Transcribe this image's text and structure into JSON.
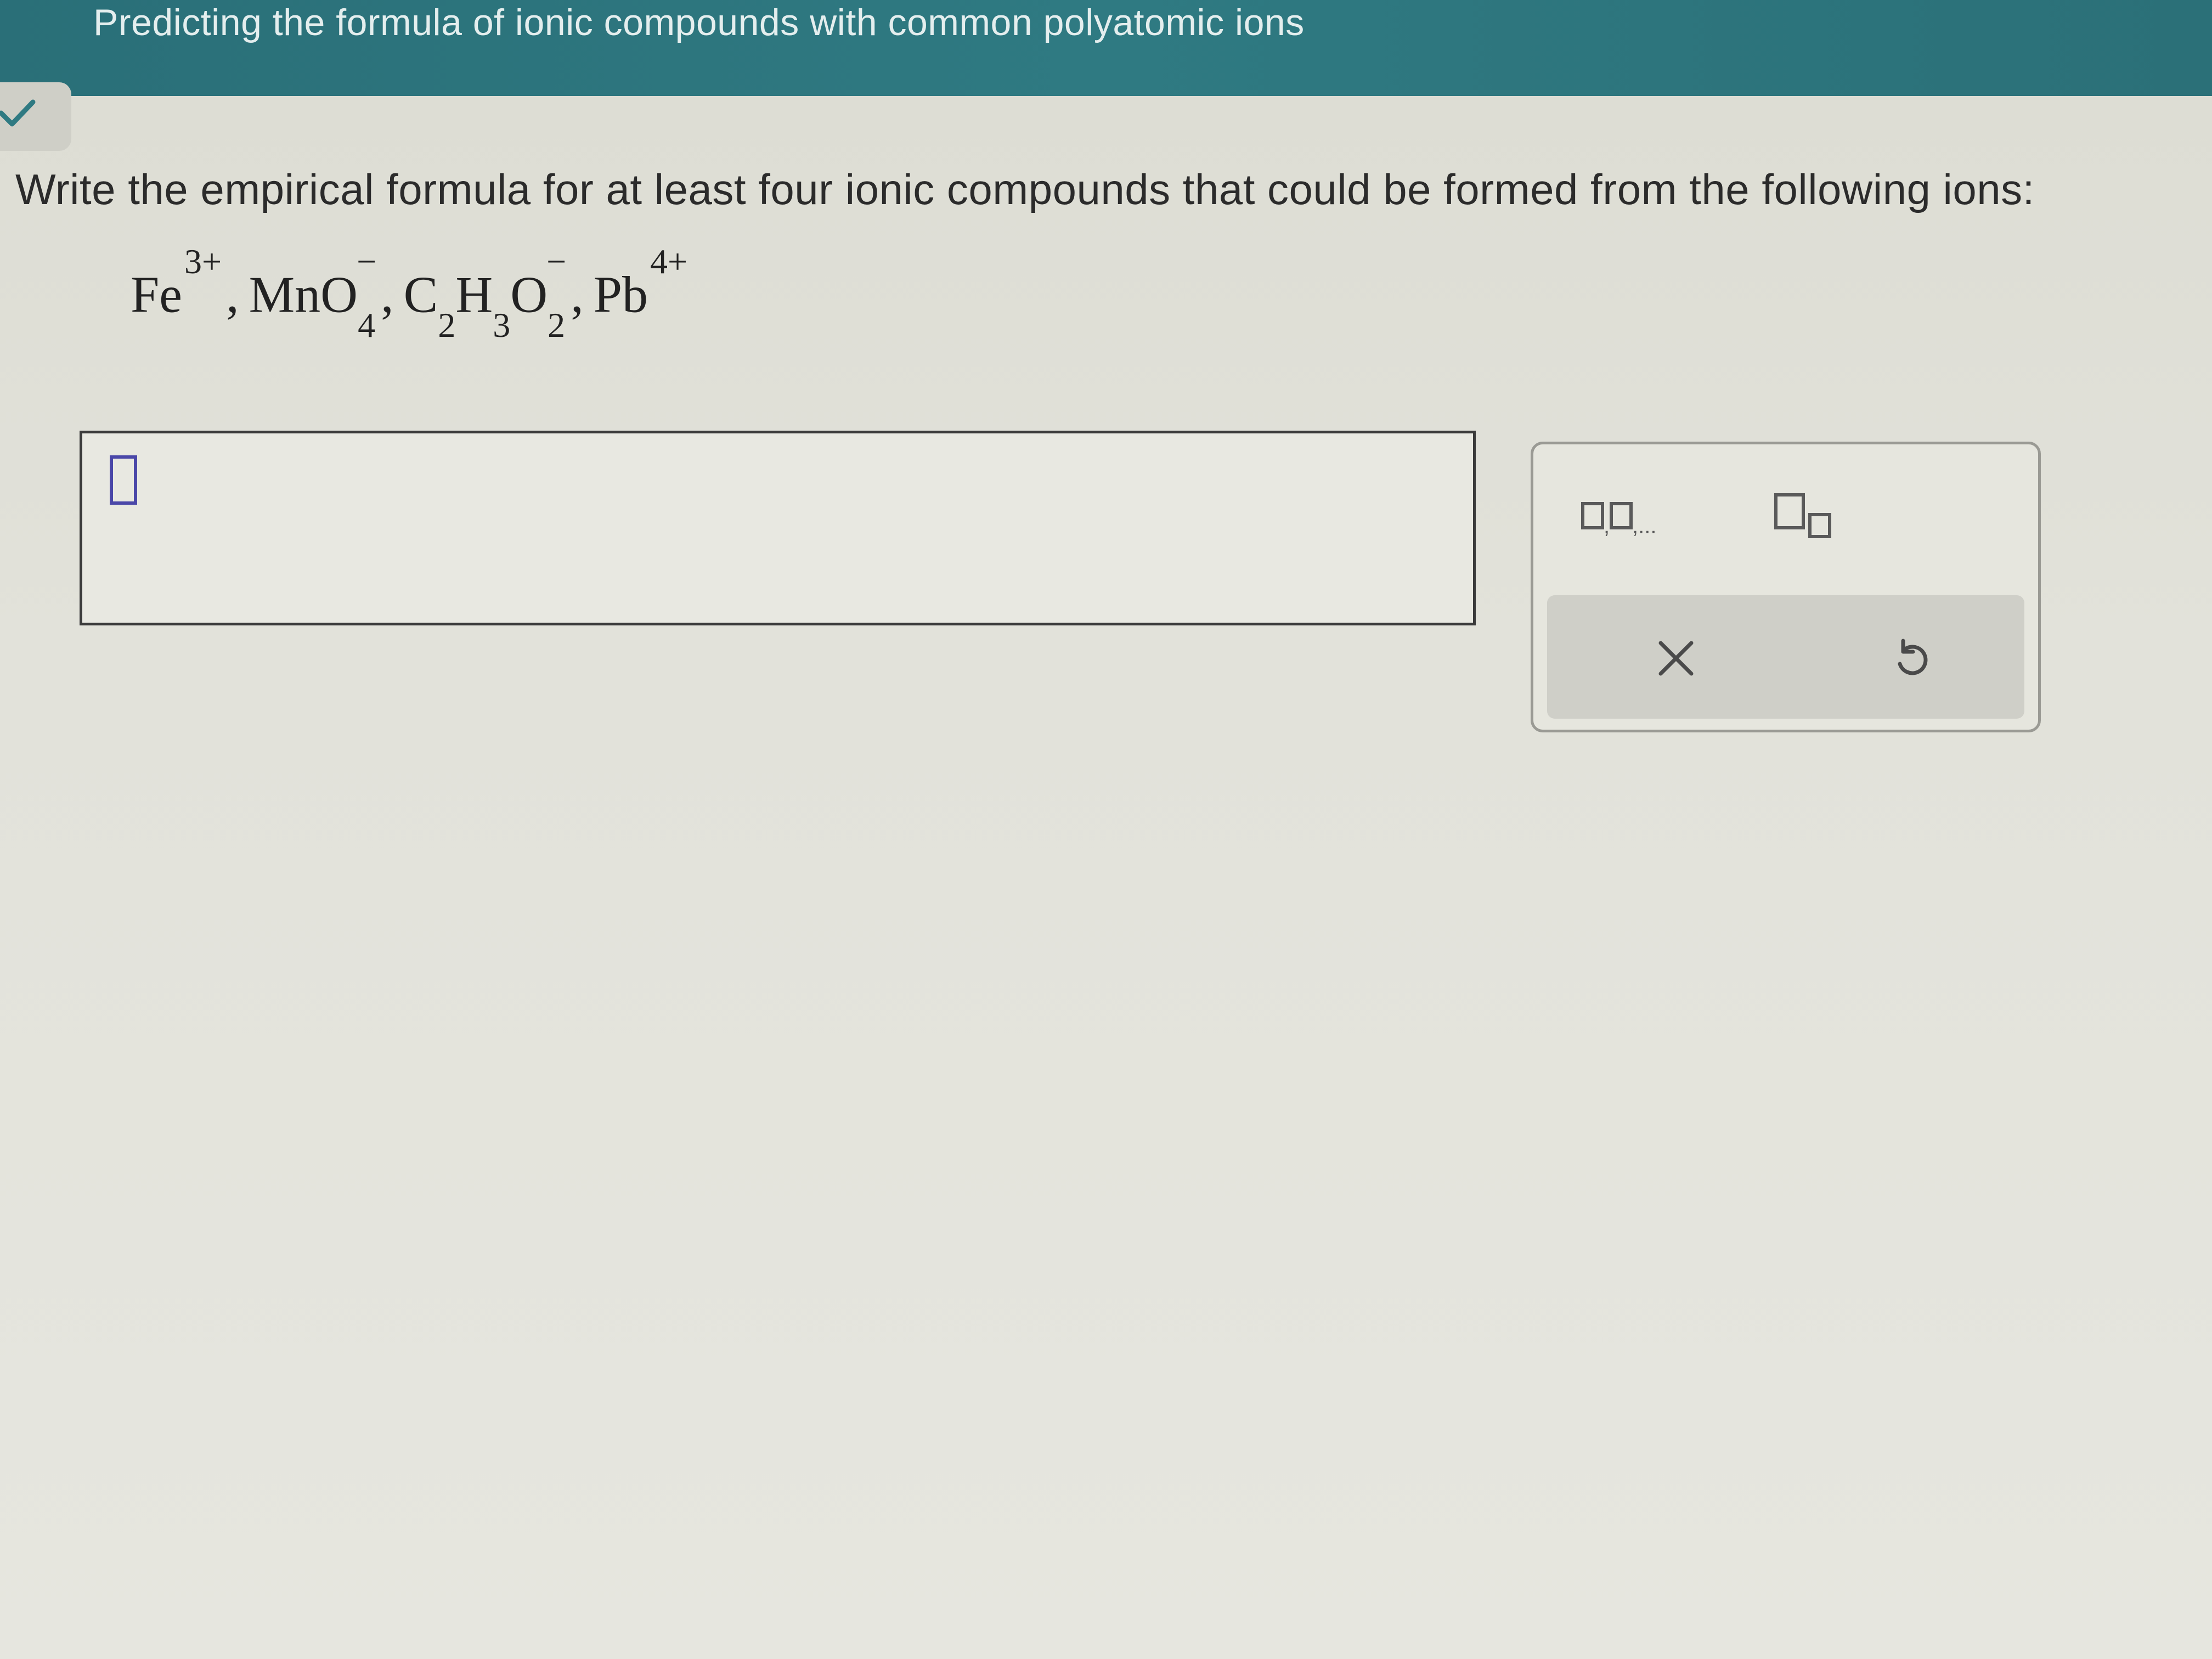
{
  "header": {
    "title": "Predicting the formula of ionic compounds with common polyatomic ions"
  },
  "question": {
    "prompt": "Write the empirical formula for at least four ionic compounds that could be formed from the following ions:",
    "ions": [
      {
        "base": "Fe",
        "sub": "",
        "charge": "3+"
      },
      {
        "base": "MnO",
        "sub": "4",
        "charge": "−"
      },
      {
        "base": "C",
        "sub": "2",
        "base2": "H",
        "sub2": "3",
        "base3": "O",
        "sub3": "2",
        "charge": "−"
      },
      {
        "base": "Pb",
        "sub": "",
        "charge": "4+"
      }
    ],
    "separator": ","
  },
  "answer": {
    "value": ""
  },
  "toolbar": {
    "list_tool_icon": "list-of-boxes-icon",
    "subscript_tool_icon": "subscript-box-icon",
    "clear_icon": "close-icon",
    "undo_icon": "undo-icon"
  },
  "colors": {
    "header": "#2f7a82",
    "cursor": "#4a47a8",
    "check": "#2f7a82"
  }
}
